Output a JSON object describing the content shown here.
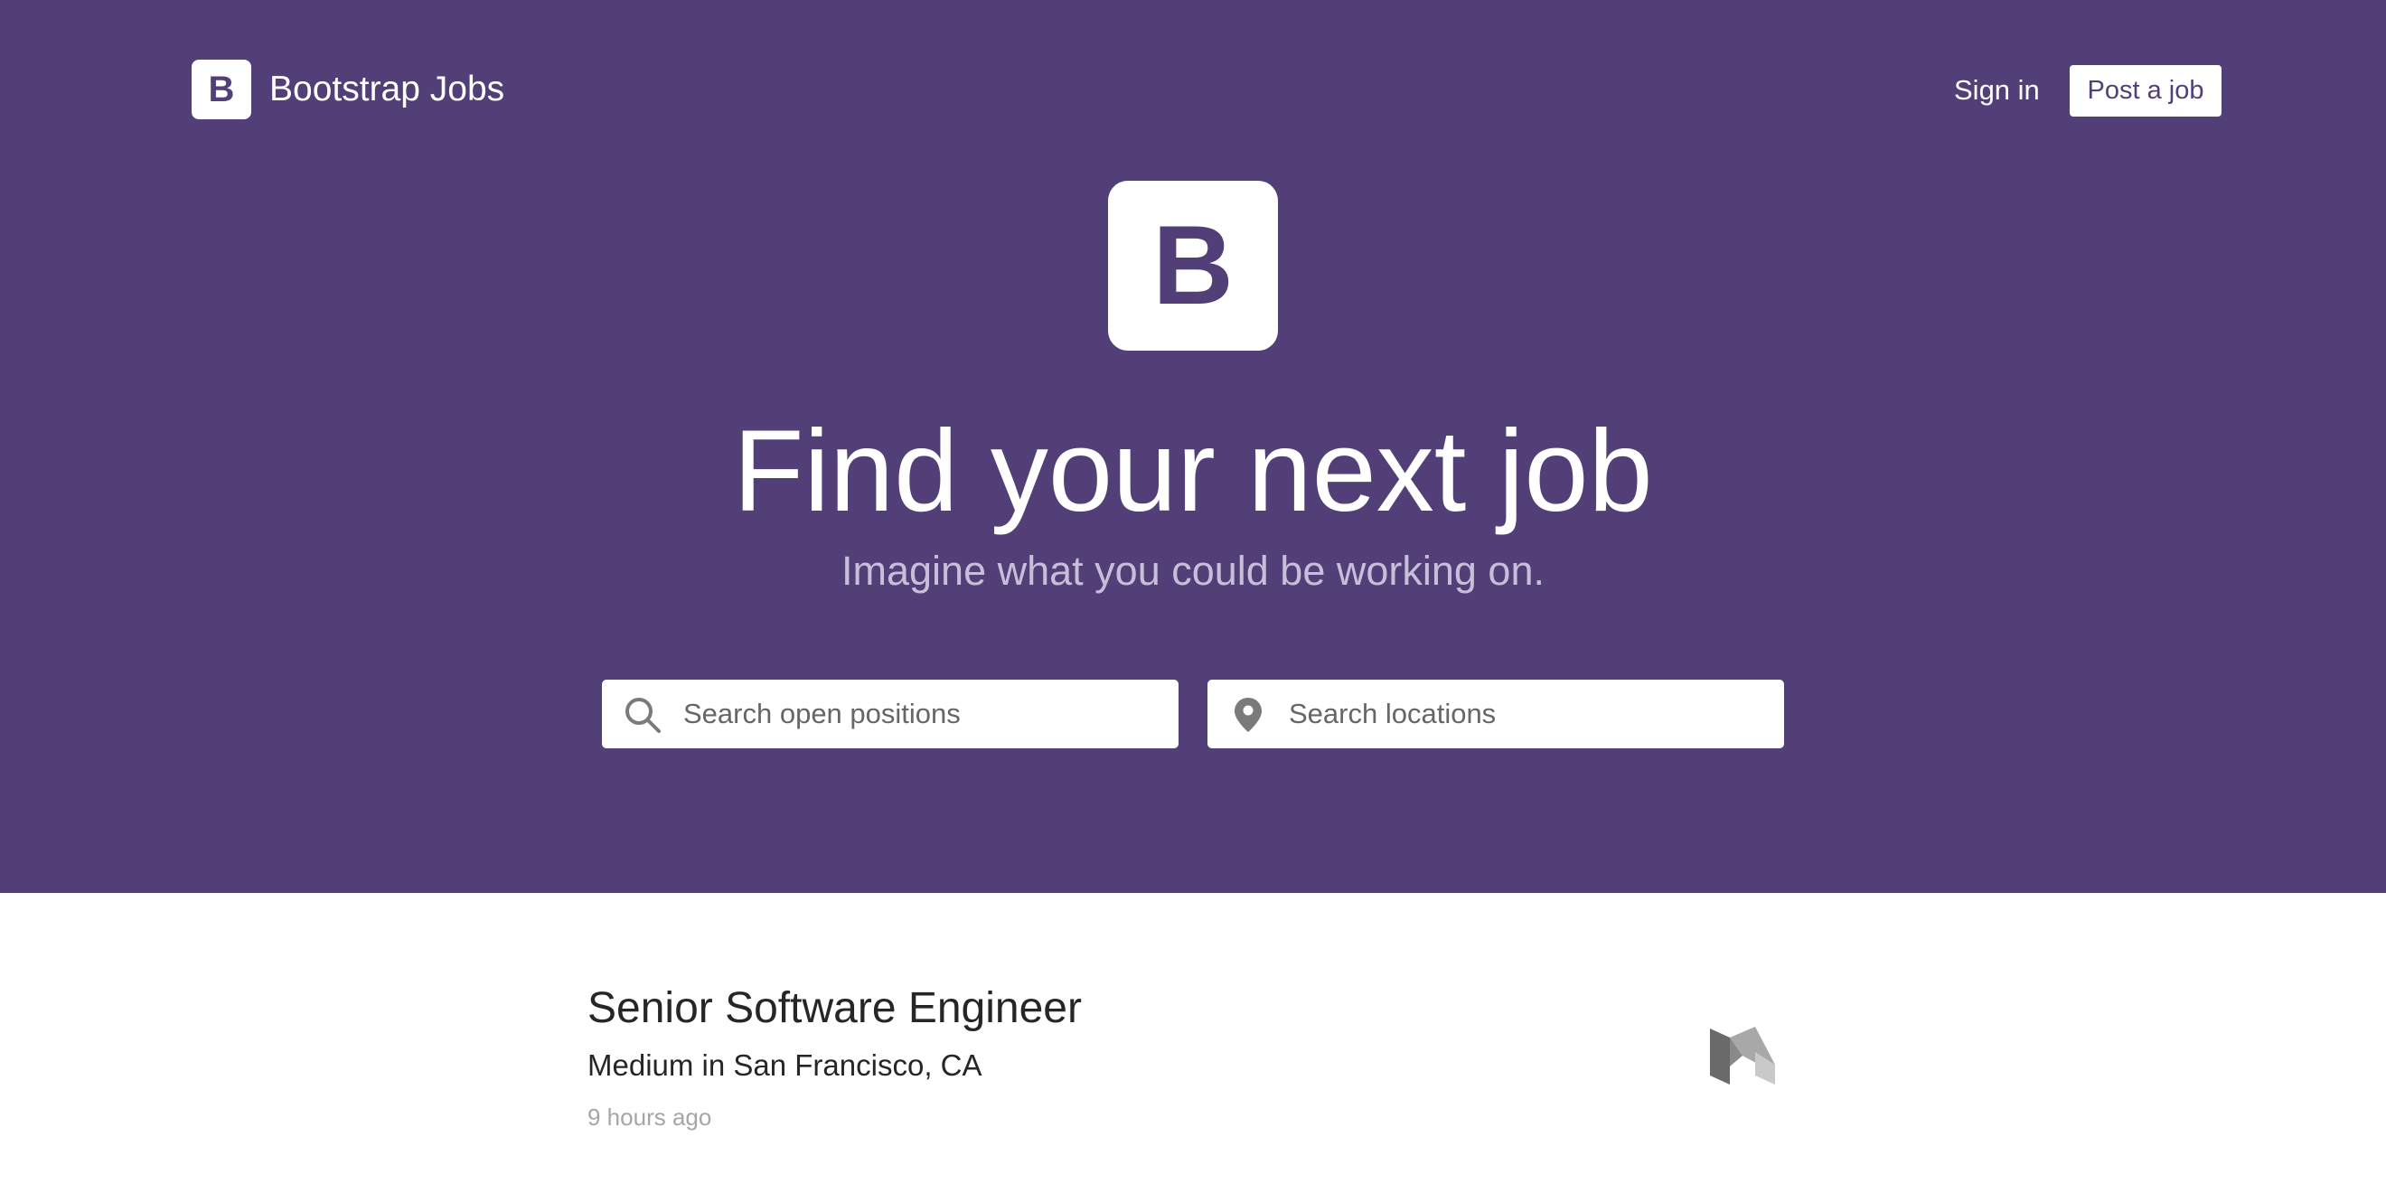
{
  "brand": {
    "badge_letter": "B",
    "name": "Bootstrap Jobs"
  },
  "nav": {
    "sign_in": "Sign in",
    "post_job": "Post a job"
  },
  "hero": {
    "logo_letter": "B",
    "headline": "Find your next job",
    "subheadline": "Imagine what you could be working on."
  },
  "search": {
    "positions_placeholder": "Search open positions",
    "locations_placeholder": "Search locations",
    "positions_icon": "search-icon",
    "locations_icon": "map-pin-icon"
  },
  "jobs": [
    {
      "title": "Senior Software Engineer",
      "company_location": "Medium in San Francisco, CA",
      "posted": "9 hours ago",
      "logo": "medium-logo"
    }
  ],
  "colors": {
    "brand_purple": "#523f78",
    "subheadline": "#c7bfda",
    "text_dark": "#262626",
    "text_muted": "#a6a6a6"
  }
}
